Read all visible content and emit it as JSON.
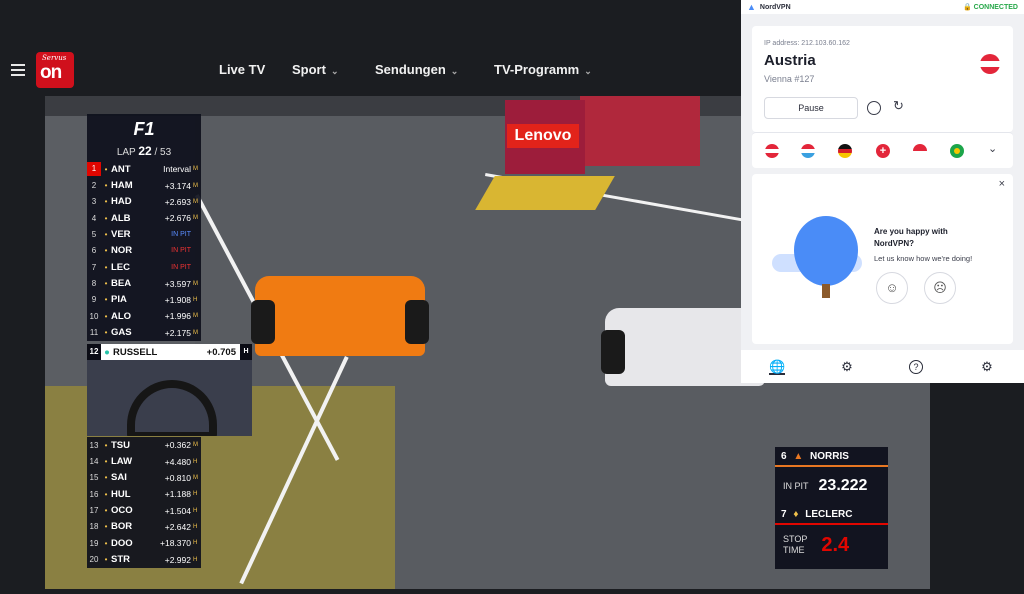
{
  "header": {
    "logo_small": "Servus",
    "logo_big": "on",
    "nav": [
      {
        "label": "Live TV",
        "dropdown": false
      },
      {
        "label": "Sport",
        "dropdown": true
      },
      {
        "label": "Sendungen",
        "dropdown": true
      },
      {
        "label": "TV-Programm",
        "dropdown": true
      }
    ]
  },
  "video": {
    "ad_sign": "Lenovo"
  },
  "leaderboard": {
    "series_logo": "F1",
    "lap_label": "LAP",
    "lap_current": "22",
    "lap_total": "/ 53",
    "rows": [
      {
        "pos": "1",
        "code": "ANT",
        "gap": "Interval",
        "flag": "M"
      },
      {
        "pos": "2",
        "code": "HAM",
        "gap": "+3.174",
        "flag": "M"
      },
      {
        "pos": "3",
        "code": "HAD",
        "gap": "+2.693",
        "flag": "M"
      },
      {
        "pos": "4",
        "code": "ALB",
        "gap": "+2.676",
        "flag": "M"
      },
      {
        "pos": "5",
        "code": "VER",
        "gap": "IN PIT",
        "flag": ""
      },
      {
        "pos": "6",
        "code": "NOR",
        "gap": "IN PIT",
        "flag": ""
      },
      {
        "pos": "7",
        "code": "LEC",
        "gap": "IN PIT",
        "flag": ""
      },
      {
        "pos": "8",
        "code": "BEA",
        "gap": "+3.597",
        "flag": "M"
      },
      {
        "pos": "9",
        "code": "PIA",
        "gap": "+1.908",
        "flag": "H"
      },
      {
        "pos": "10",
        "code": "ALO",
        "gap": "+1.996",
        "flag": "M"
      },
      {
        "pos": "11",
        "code": "GAS",
        "gap": "+2.175",
        "flag": "M"
      }
    ],
    "highlight": {
      "pos": "12",
      "code": "RUSSELL",
      "gap": "+0.705",
      "flag": "H"
    },
    "rows2": [
      {
        "pos": "13",
        "code": "TSU",
        "gap": "+0.362",
        "flag": "M"
      },
      {
        "pos": "14",
        "code": "LAW",
        "gap": "+4.480",
        "flag": "H"
      },
      {
        "pos": "15",
        "code": "SAI",
        "gap": "+0.810",
        "flag": "M"
      },
      {
        "pos": "16",
        "code": "HUL",
        "gap": "+1.188",
        "flag": "H"
      },
      {
        "pos": "17",
        "code": "OCO",
        "gap": "+1.504",
        "flag": "H"
      },
      {
        "pos": "18",
        "code": "BOR",
        "gap": "+2.642",
        "flag": "H"
      },
      {
        "pos": "19",
        "code": "DOO",
        "gap": "+18.370",
        "flag": "H"
      },
      {
        "pos": "20",
        "code": "STR",
        "gap": "+2.992",
        "flag": "H"
      }
    ]
  },
  "pitbox": {
    "driver1_pos": "6",
    "driver1": "NORRIS",
    "in_pit_label": "IN PIT",
    "in_pit_time": "23.222",
    "driver2_pos": "7",
    "driver2": "LECLERC",
    "stop_label_1": "STOP",
    "stop_label_2": "TIME",
    "stop_time": "2.4"
  },
  "vpn": {
    "brand": "NordVPN",
    "status": "CONNECTED",
    "ip_label": "IP address: 212.103.60.162",
    "country": "Austria",
    "server": "Vienna #127",
    "pause_label": "Pause",
    "happy_title_1": "Are you happy with",
    "happy_title_2": "NordVPN?",
    "happy_sub": "Let us know how we're doing!",
    "close": "×"
  },
  "colors": {
    "accent_red": "#d0101c",
    "vpn_connected": "#27a84a",
    "f1_red": "#e10600"
  }
}
